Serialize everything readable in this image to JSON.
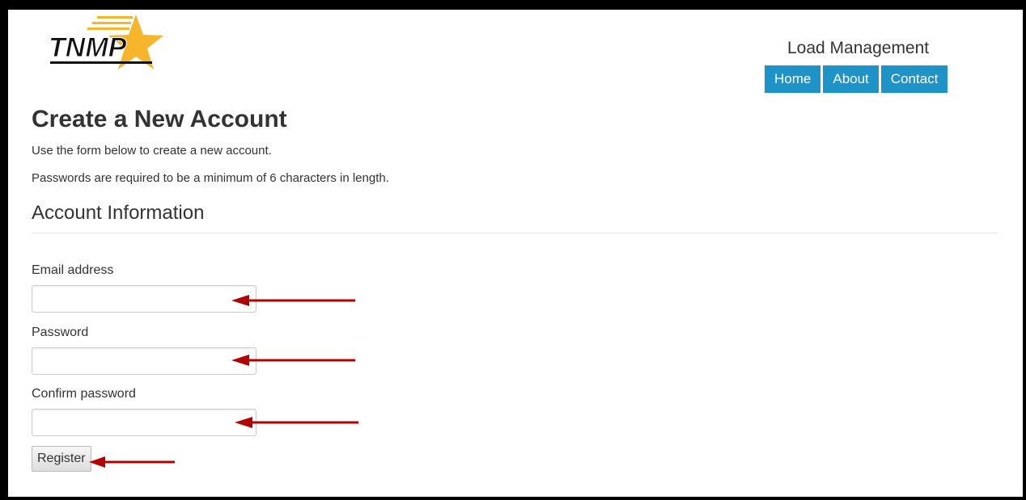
{
  "header": {
    "logo_text": "TNMP",
    "site_title": "Load Management",
    "nav": [
      {
        "label": "Home"
      },
      {
        "label": "About"
      },
      {
        "label": "Contact"
      }
    ]
  },
  "main": {
    "title": "Create a New Account",
    "intro": "Use the form below to create a new account.",
    "password_rule": "Passwords are required to be a minimum of 6 characters in length.",
    "section_title": "Account Information",
    "fields": [
      {
        "label": "Email address",
        "value": ""
      },
      {
        "label": "Password",
        "value": ""
      },
      {
        "label": "Confirm password",
        "value": ""
      }
    ],
    "register_label": "Register"
  },
  "colors": {
    "nav_background": "#1e93c7",
    "logo_star": "#f7b52a",
    "annotation_arrow": "#b30000"
  }
}
